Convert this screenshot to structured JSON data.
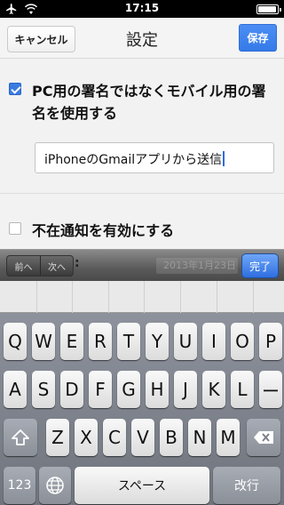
{
  "status_bar": {
    "time": "17:15",
    "battery_level": 0.95
  },
  "nav": {
    "cancel_label": "キャンセル",
    "title": "設定",
    "save_label": "保存"
  },
  "settings": {
    "signature_option": {
      "label": "PC用の署名ではなくモバイル用の署名を使用する",
      "checked": true
    },
    "signature_value": "iPhoneのGmailアプリから送信",
    "vacation_option": {
      "label": "不在通知を有効にする",
      "checked": false
    }
  },
  "accessory": {
    "prev_label": "前へ",
    "next_label": "次へ",
    "partial_label": ":",
    "date_value": "2013年1月23日",
    "done_label": "完了"
  },
  "keyboard": {
    "row1": [
      "Q",
      "W",
      "E",
      "R",
      "T",
      "Y",
      "U",
      "I",
      "O",
      "P"
    ],
    "row2": [
      "A",
      "S",
      "D",
      "F",
      "G",
      "H",
      "J",
      "K",
      "L",
      "ー"
    ],
    "row3": [
      "Z",
      "X",
      "C",
      "V",
      "B",
      "N",
      "M"
    ],
    "numbers_label": "123",
    "space_label": "スペース",
    "return_label": "改行"
  },
  "icons": {
    "airplane": "airplane-icon",
    "wifi": "wifi-icon",
    "shift": "shift-icon",
    "backspace": "backspace-icon",
    "globe": "globe-icon"
  },
  "colors": {
    "accent": "#3b7be0",
    "save_button": "#4285f4",
    "caret": "#2d6ae3"
  }
}
